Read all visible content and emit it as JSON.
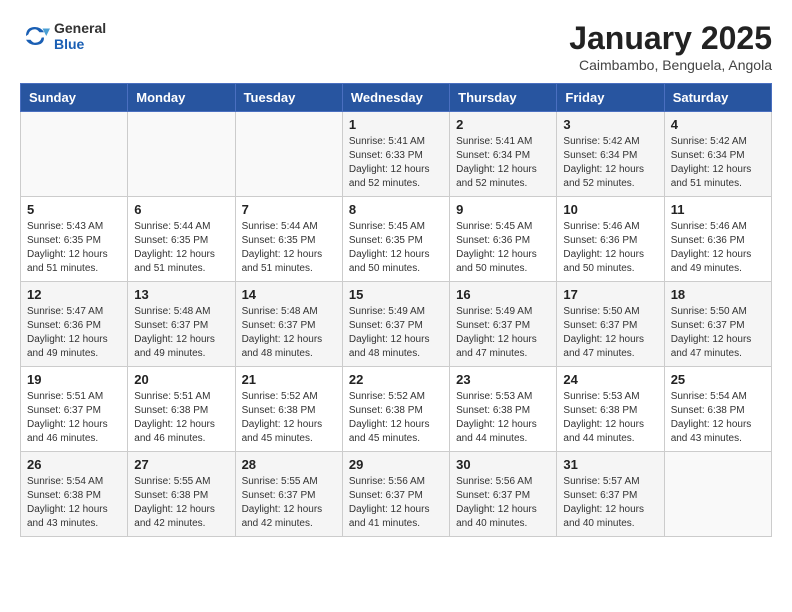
{
  "header": {
    "logo_general": "General",
    "logo_blue": "Blue",
    "month_title": "January 2025",
    "location": "Caimbambo, Benguela, Angola"
  },
  "days_of_week": [
    "Sunday",
    "Monday",
    "Tuesday",
    "Wednesday",
    "Thursday",
    "Friday",
    "Saturday"
  ],
  "weeks": [
    [
      {
        "num": "",
        "info": ""
      },
      {
        "num": "",
        "info": ""
      },
      {
        "num": "",
        "info": ""
      },
      {
        "num": "1",
        "info": "Sunrise: 5:41 AM\nSunset: 6:33 PM\nDaylight: 12 hours\nand 52 minutes."
      },
      {
        "num": "2",
        "info": "Sunrise: 5:41 AM\nSunset: 6:34 PM\nDaylight: 12 hours\nand 52 minutes."
      },
      {
        "num": "3",
        "info": "Sunrise: 5:42 AM\nSunset: 6:34 PM\nDaylight: 12 hours\nand 52 minutes."
      },
      {
        "num": "4",
        "info": "Sunrise: 5:42 AM\nSunset: 6:34 PM\nDaylight: 12 hours\nand 51 minutes."
      }
    ],
    [
      {
        "num": "5",
        "info": "Sunrise: 5:43 AM\nSunset: 6:35 PM\nDaylight: 12 hours\nand 51 minutes."
      },
      {
        "num": "6",
        "info": "Sunrise: 5:44 AM\nSunset: 6:35 PM\nDaylight: 12 hours\nand 51 minutes."
      },
      {
        "num": "7",
        "info": "Sunrise: 5:44 AM\nSunset: 6:35 PM\nDaylight: 12 hours\nand 51 minutes."
      },
      {
        "num": "8",
        "info": "Sunrise: 5:45 AM\nSunset: 6:35 PM\nDaylight: 12 hours\nand 50 minutes."
      },
      {
        "num": "9",
        "info": "Sunrise: 5:45 AM\nSunset: 6:36 PM\nDaylight: 12 hours\nand 50 minutes."
      },
      {
        "num": "10",
        "info": "Sunrise: 5:46 AM\nSunset: 6:36 PM\nDaylight: 12 hours\nand 50 minutes."
      },
      {
        "num": "11",
        "info": "Sunrise: 5:46 AM\nSunset: 6:36 PM\nDaylight: 12 hours\nand 49 minutes."
      }
    ],
    [
      {
        "num": "12",
        "info": "Sunrise: 5:47 AM\nSunset: 6:36 PM\nDaylight: 12 hours\nand 49 minutes."
      },
      {
        "num": "13",
        "info": "Sunrise: 5:48 AM\nSunset: 6:37 PM\nDaylight: 12 hours\nand 49 minutes."
      },
      {
        "num": "14",
        "info": "Sunrise: 5:48 AM\nSunset: 6:37 PM\nDaylight: 12 hours\nand 48 minutes."
      },
      {
        "num": "15",
        "info": "Sunrise: 5:49 AM\nSunset: 6:37 PM\nDaylight: 12 hours\nand 48 minutes."
      },
      {
        "num": "16",
        "info": "Sunrise: 5:49 AM\nSunset: 6:37 PM\nDaylight: 12 hours\nand 47 minutes."
      },
      {
        "num": "17",
        "info": "Sunrise: 5:50 AM\nSunset: 6:37 PM\nDaylight: 12 hours\nand 47 minutes."
      },
      {
        "num": "18",
        "info": "Sunrise: 5:50 AM\nSunset: 6:37 PM\nDaylight: 12 hours\nand 47 minutes."
      }
    ],
    [
      {
        "num": "19",
        "info": "Sunrise: 5:51 AM\nSunset: 6:37 PM\nDaylight: 12 hours\nand 46 minutes."
      },
      {
        "num": "20",
        "info": "Sunrise: 5:51 AM\nSunset: 6:38 PM\nDaylight: 12 hours\nand 46 minutes."
      },
      {
        "num": "21",
        "info": "Sunrise: 5:52 AM\nSunset: 6:38 PM\nDaylight: 12 hours\nand 45 minutes."
      },
      {
        "num": "22",
        "info": "Sunrise: 5:52 AM\nSunset: 6:38 PM\nDaylight: 12 hours\nand 45 minutes."
      },
      {
        "num": "23",
        "info": "Sunrise: 5:53 AM\nSunset: 6:38 PM\nDaylight: 12 hours\nand 44 minutes."
      },
      {
        "num": "24",
        "info": "Sunrise: 5:53 AM\nSunset: 6:38 PM\nDaylight: 12 hours\nand 44 minutes."
      },
      {
        "num": "25",
        "info": "Sunrise: 5:54 AM\nSunset: 6:38 PM\nDaylight: 12 hours\nand 43 minutes."
      }
    ],
    [
      {
        "num": "26",
        "info": "Sunrise: 5:54 AM\nSunset: 6:38 PM\nDaylight: 12 hours\nand 43 minutes."
      },
      {
        "num": "27",
        "info": "Sunrise: 5:55 AM\nSunset: 6:38 PM\nDaylight: 12 hours\nand 42 minutes."
      },
      {
        "num": "28",
        "info": "Sunrise: 5:55 AM\nSunset: 6:37 PM\nDaylight: 12 hours\nand 42 minutes."
      },
      {
        "num": "29",
        "info": "Sunrise: 5:56 AM\nSunset: 6:37 PM\nDaylight: 12 hours\nand 41 minutes."
      },
      {
        "num": "30",
        "info": "Sunrise: 5:56 AM\nSunset: 6:37 PM\nDaylight: 12 hours\nand 40 minutes."
      },
      {
        "num": "31",
        "info": "Sunrise: 5:57 AM\nSunset: 6:37 PM\nDaylight: 12 hours\nand 40 minutes."
      },
      {
        "num": "",
        "info": ""
      }
    ]
  ]
}
